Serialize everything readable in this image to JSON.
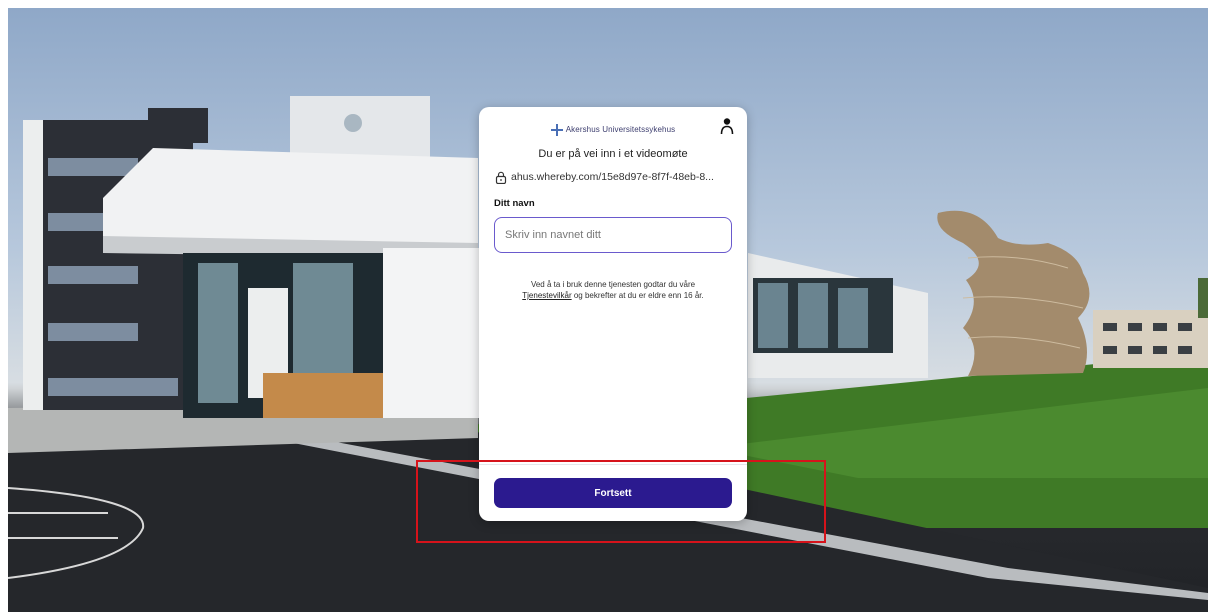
{
  "brand": {
    "name": "Akershus Universitetssykehus",
    "icon": "cross-logo-icon"
  },
  "heading": "Du er på vei inn i et videomøte",
  "room_url": "ahus.whereby.com/15e8d97e-8f7f-48eb-8...",
  "name_field": {
    "label": "Ditt navn",
    "placeholder": "Skriv inn navnet ditt",
    "value": ""
  },
  "terms": {
    "before": "Ved å ta i bruk denne tjenesten godtar du våre",
    "link": "Tjenestevilkår",
    "after": " og bekrefter at du er eldre enn 16 år."
  },
  "continue_button": "Fortsett",
  "colors": {
    "primary": "#2b1a8f",
    "input_border": "#6a5acd",
    "highlight": "#d6131b"
  }
}
